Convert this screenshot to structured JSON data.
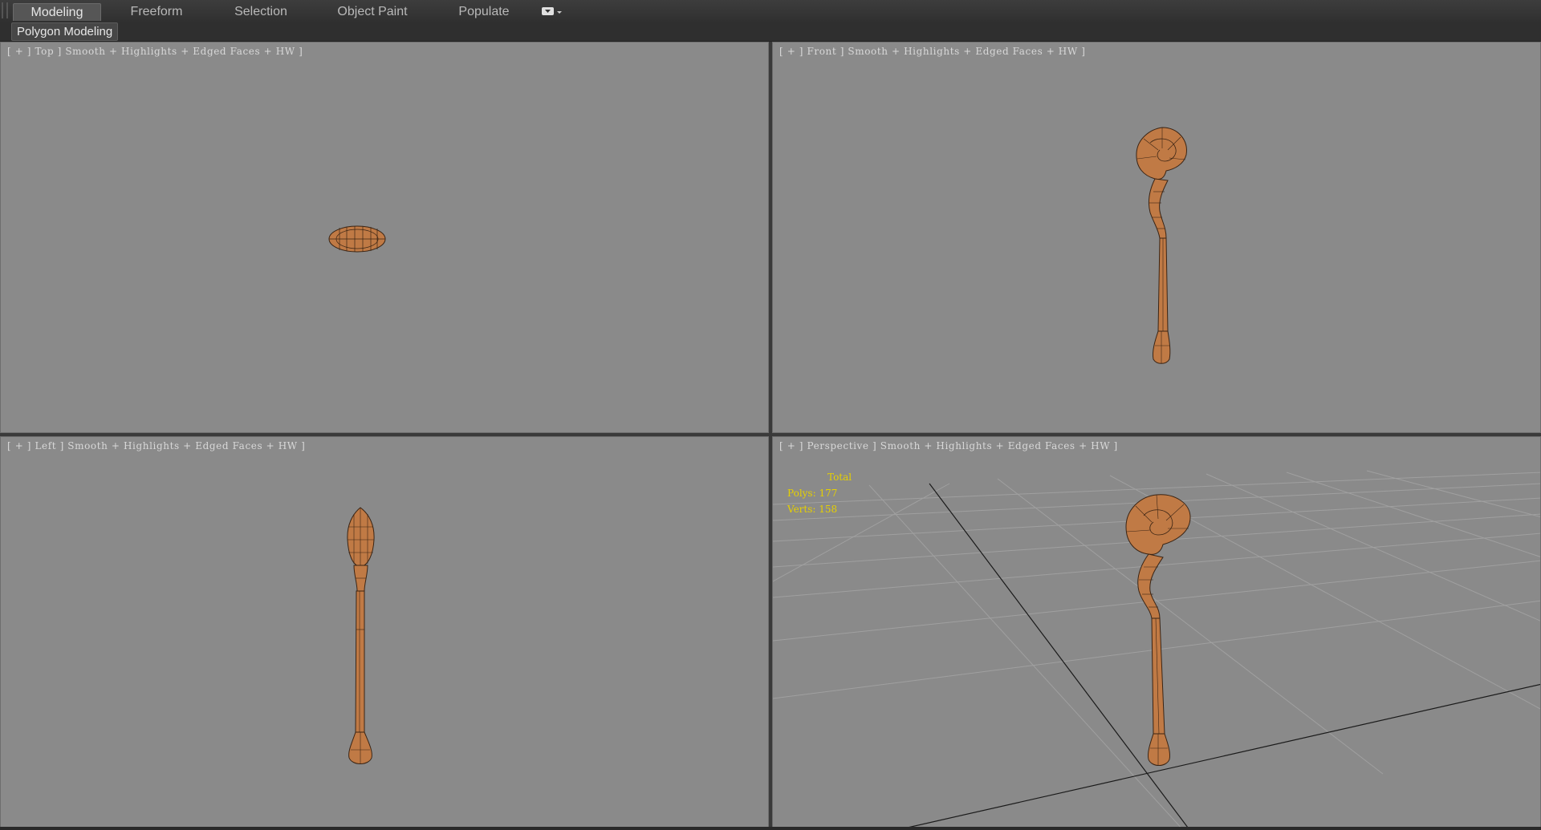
{
  "ribbon": {
    "tabs": [
      {
        "label": "Modeling",
        "active": true
      },
      {
        "label": "Freeform",
        "active": false
      },
      {
        "label": "Selection",
        "active": false
      },
      {
        "label": "Object Paint",
        "active": false
      },
      {
        "label": "Populate",
        "active": false
      }
    ],
    "menu_icon": "ribbon-options-icon"
  },
  "subbar": {
    "panel_label": "Polygon Modeling"
  },
  "viewports": {
    "top": {
      "label": "[ + ] Top ] Smooth + Highlights + Edged Faces + HW ]"
    },
    "front": {
      "label": "[ + ] Front ] Smooth + Highlights + Edged Faces + HW ]"
    },
    "left": {
      "label": "[ + ] Left ] Smooth + Highlights + Edged Faces + HW ]"
    },
    "perspective": {
      "label": "[ + ] Perspective ] Smooth + Highlights + Edged Faces + HW ]"
    }
  },
  "stats": {
    "title": "Total",
    "polys": "Polys: 177",
    "verts": "Verts: 158"
  },
  "colors": {
    "viewport_bg": "#8a8a8a",
    "model_fill": "#c07a45",
    "model_edge": "#3a2414",
    "stats_text": "#e6d000"
  }
}
